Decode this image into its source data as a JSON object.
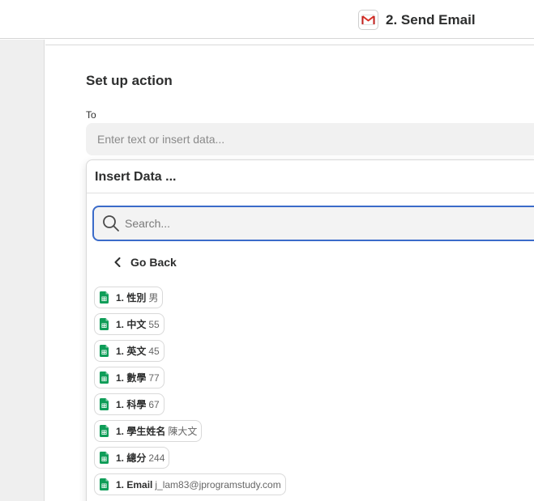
{
  "header": {
    "step_title": "2. Send Email",
    "app_icon": "gmail-icon"
  },
  "main": {
    "section_title": "Set up action",
    "to_label": "To",
    "to_placeholder": "Enter text or insert data..."
  },
  "insert_data": {
    "title": "Insert Data ...",
    "search_placeholder": "Search...",
    "go_back_label": "Go Back",
    "items": [
      {
        "label": "1. 性別",
        "value": "男",
        "icon": "google-sheets-icon"
      },
      {
        "label": "1. 中文",
        "value": "55",
        "icon": "google-sheets-icon"
      },
      {
        "label": "1. 英文",
        "value": "45",
        "icon": "google-sheets-icon"
      },
      {
        "label": "1. 數學",
        "value": "77",
        "icon": "google-sheets-icon"
      },
      {
        "label": "1. 科學",
        "value": "67",
        "icon": "google-sheets-icon"
      },
      {
        "label": "1. 學生姓名",
        "value": "陳大文",
        "icon": "google-sheets-icon"
      },
      {
        "label": "1. 總分",
        "value": "244",
        "icon": "google-sheets-icon"
      },
      {
        "label": "1. Email",
        "value": "j_lam83@jprogramstudy.com",
        "icon": "google-sheets-icon"
      }
    ]
  },
  "colors": {
    "accent_blue": "#3a6bc9",
    "sheets_green": "#0f9d58",
    "gmail_red": "#d93025"
  }
}
